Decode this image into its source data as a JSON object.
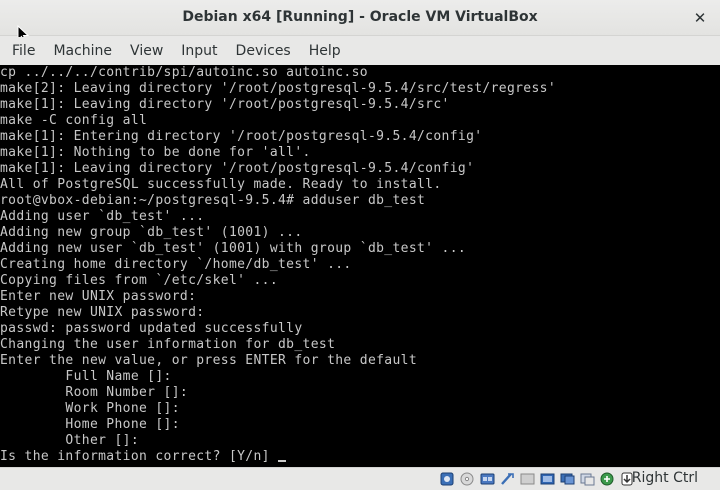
{
  "window": {
    "title": "Debian x64 [Running] - Oracle VM VirtualBox",
    "close_glyph": "✕"
  },
  "menu": [
    {
      "label": "File"
    },
    {
      "label": "Machine"
    },
    {
      "label": "View"
    },
    {
      "label": "Input"
    },
    {
      "label": "Devices"
    },
    {
      "label": "Help"
    }
  ],
  "terminal": {
    "lines": [
      "cp ../../../contrib/spi/autoinc.so autoinc.so",
      "make[2]: Leaving directory '/root/postgresql-9.5.4/src/test/regress'",
      "make[1]: Leaving directory '/root/postgresql-9.5.4/src'",
      "make -C config all",
      "make[1]: Entering directory '/root/postgresql-9.5.4/config'",
      "make[1]: Nothing to be done for 'all'.",
      "make[1]: Leaving directory '/root/postgresql-9.5.4/config'",
      "All of PostgreSQL successfully made. Ready to install.",
      "root@vbox-debian:~/postgresql-9.5.4# adduser db_test",
      "Adding user `db_test' ...",
      "Adding new group `db_test' (1001) ...",
      "Adding new user `db_test' (1001) with group `db_test' ...",
      "Creating home directory `/home/db_test' ...",
      "Copying files from `/etc/skel' ...",
      "Enter new UNIX password:",
      "Retype new UNIX password:",
      "passwd: password updated successfully",
      "Changing the user information for db_test",
      "Enter the new value, or press ENTER for the default",
      "        Full Name []:",
      "        Room Number []:",
      "        Work Phone []:",
      "        Home Phone []:",
      "        Other []:"
    ],
    "prompt": "Is the information correct? [Y/n] "
  },
  "statusbar": {
    "icons": [
      "hard-disk-icon",
      "optical-drive-icon",
      "audio-icon",
      "network-icon",
      "usb-icon",
      "shared-folder-icon",
      "display-icon",
      "video-capture-icon",
      "cpu-icon",
      "mouse-integration-icon",
      "keyboard-capture-icon"
    ],
    "host_key": "Right Ctrl"
  }
}
